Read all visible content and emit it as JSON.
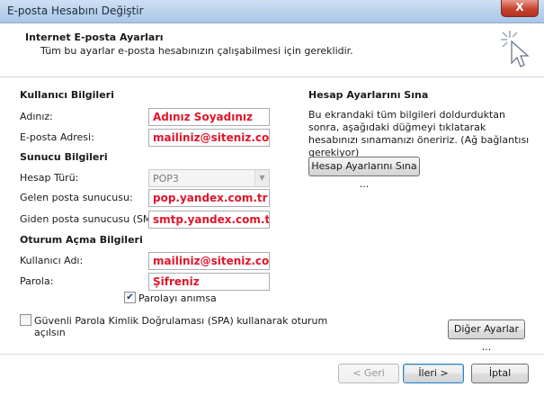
{
  "window": {
    "title": "E-posta Hesabını Değiştir",
    "close": "X"
  },
  "header": {
    "title": "Internet E-posta Ayarları",
    "subtitle": "Tüm bu ayarlar e-posta hesabınızın çalışabilmesi için gereklidir."
  },
  "user": {
    "section": "Kullanıcı Bilgileri",
    "name_label": "Adınız:",
    "name_value": "Adınız Soyadınız",
    "email_label": "E-posta Adresi:",
    "email_value": "mailiniz@siteniz.com"
  },
  "server": {
    "section": "Sunucu Bilgileri",
    "type_label": "Hesap Türü:",
    "type_value": "POP3",
    "incoming_label": "Gelen posta sunucusu:",
    "incoming_value": "pop.yandex.com.tr",
    "outgoing_label": "Giden posta sunucusu (SMTP):",
    "outgoing_value": "smtp.yandex.com.tr"
  },
  "logon": {
    "section": "Oturum Açma Bilgileri",
    "username_label": "Kullanıcı Adı:",
    "username_value": "mailiniz@siteniz.com",
    "password_label": "Parola:",
    "password_value": "Şifreniz",
    "remember_label": "Parolayı anımsa",
    "remember_checked": true,
    "spa_label_line1": "Güvenli Parola Kimlik Doğrulaması (SPA) kullanarak oturum",
    "spa_label_line2": "açılsın",
    "spa_checked": false
  },
  "test": {
    "section": "Hesap Ayarlarını Sına",
    "description": "Bu ekrandaki tüm bilgileri doldurduktan sonra, aşağıdaki düğmeyi tıklatarak hesabınızı sınamanızı öneririz. (Ağ bağlantısı gerekiyor)",
    "button": "Hesap Ayarlarını Sına ...",
    "more_button": "Diğer Ayarlar ..."
  },
  "footer": {
    "back": "< Geri",
    "next": "İleri >",
    "cancel": "İptal"
  },
  "colors": {
    "value_text": "#e0152a",
    "title_bar": "#b9d1ec"
  }
}
